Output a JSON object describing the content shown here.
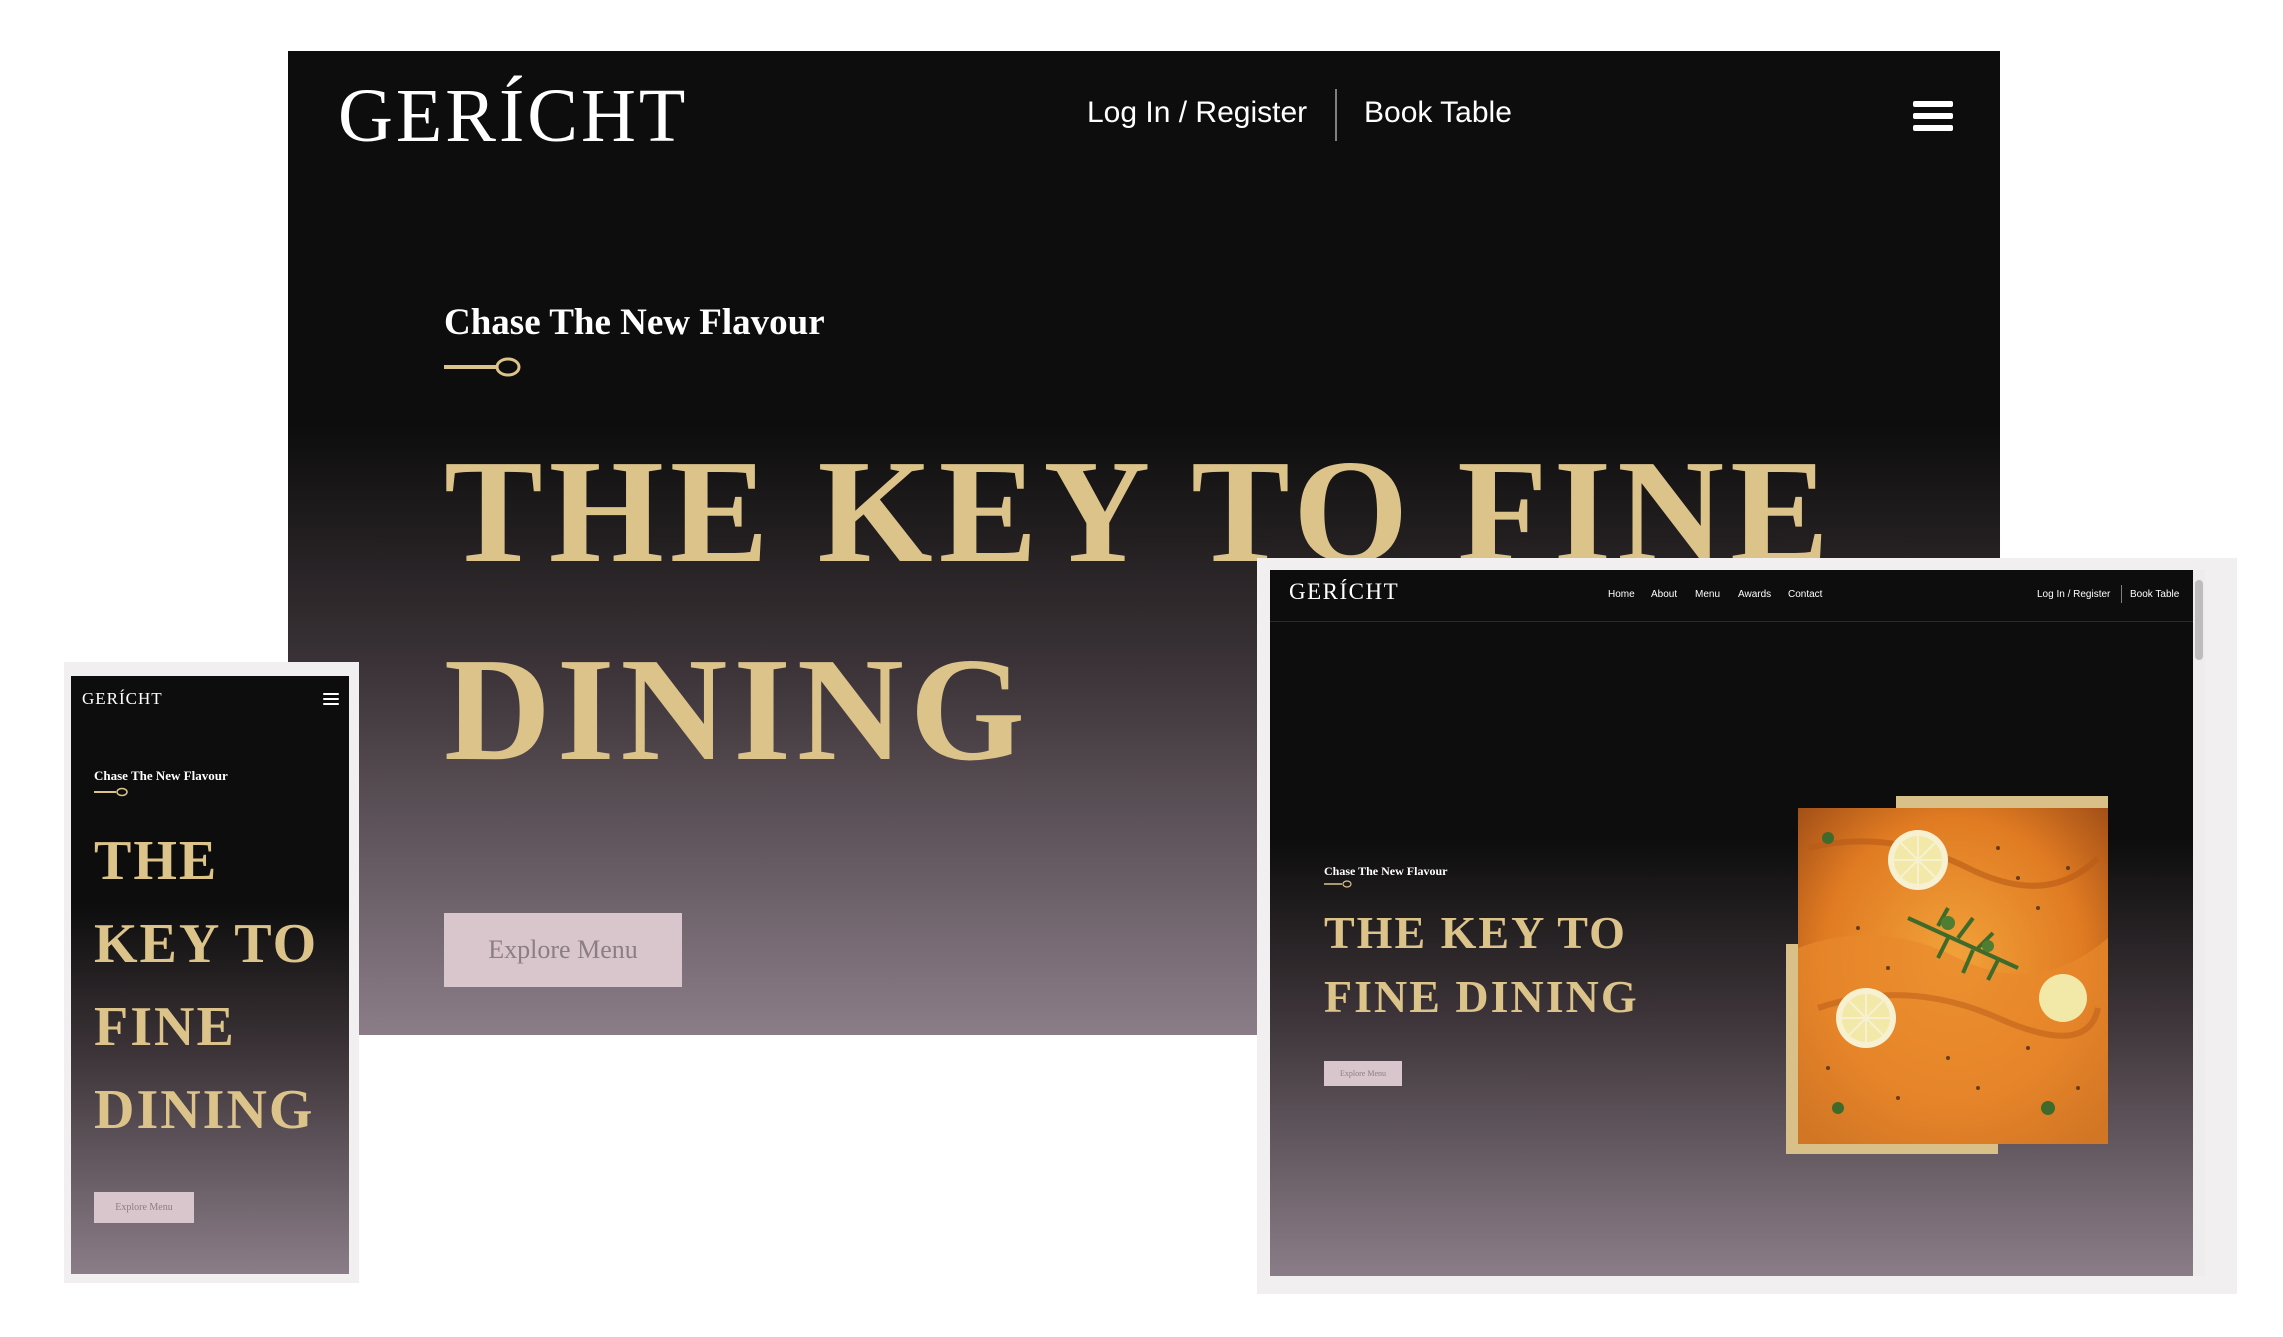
{
  "brand": {
    "logo": "GERÍCHT"
  },
  "desktop": {
    "nav": {
      "login": "Log In / Register",
      "book": "Book Table"
    },
    "tagline": "Chase The New Flavour",
    "headline_lines": [
      "THE KEY TO FINE",
      "DINING"
    ],
    "cta": "Explore Menu"
  },
  "mobile": {
    "tagline": "Chase The New Flavour",
    "headline_lines": [
      "THE",
      "KEY TO",
      "FINE",
      "DINING"
    ],
    "cta": "Explore Menu"
  },
  "laptop": {
    "nav_links": [
      "Home",
      "About",
      "Menu",
      "Awards",
      "Contact"
    ],
    "login": "Log In / Register",
    "book": "Book Table",
    "tagline": "Chase The New Flavour",
    "headline_lines": [
      "THE KEY TO",
      "FINE DINING"
    ],
    "cta": "Explore Menu",
    "image_icon": "salmon-dish-image"
  },
  "colors": {
    "accent_gold": "#dcc38a",
    "background_dark": "#0d0d0d",
    "gradient_bottom": "#8b7d88",
    "button_bg": "#d9c6cc"
  }
}
